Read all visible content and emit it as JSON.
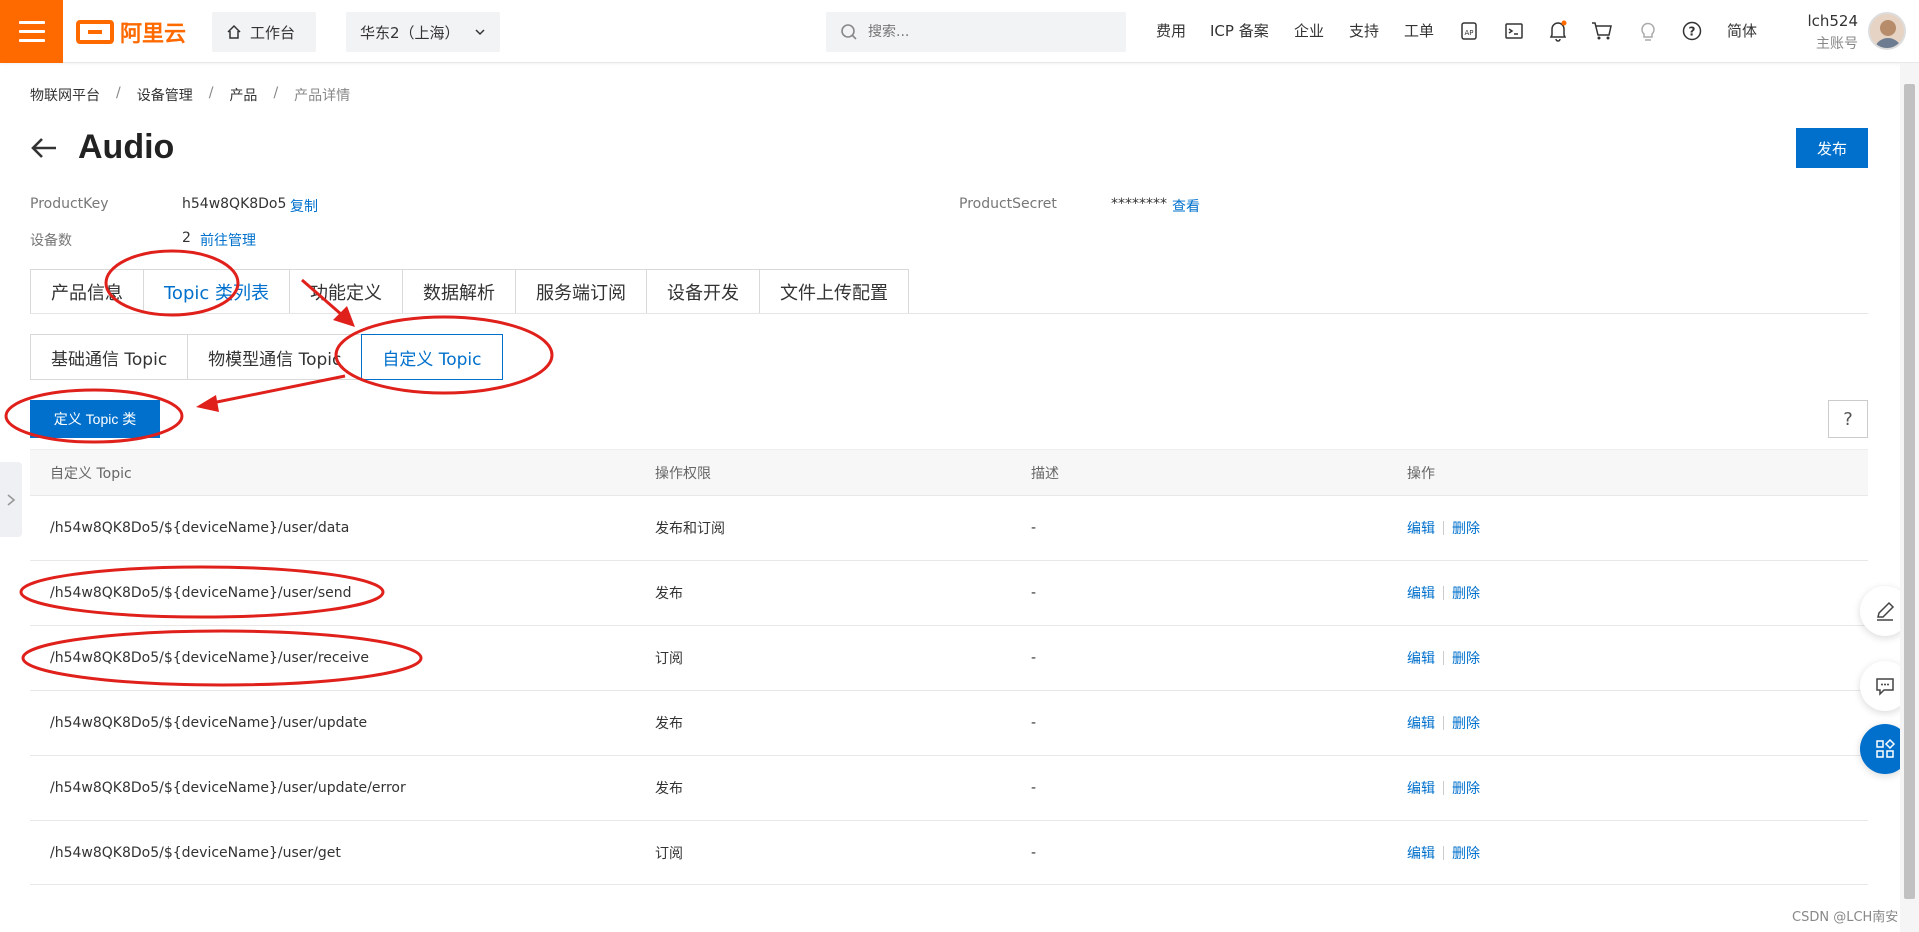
{
  "header": {
    "logo_text": "阿里云",
    "workbench_label": "工作台",
    "region_label": "华东2（上海）",
    "search_placeholder": "搜索...",
    "nav_links": [
      "费用",
      "ICP 备案",
      "企业",
      "支持",
      "工单"
    ],
    "lang_label": "简体",
    "user_name": "lch524",
    "user_role": "主账号"
  },
  "breadcrumb": [
    "物联网平台",
    "设备管理",
    "产品",
    "产品详情"
  ],
  "page": {
    "title": "Audio",
    "publish_label": "发布"
  },
  "meta": {
    "product_key_label": "ProductKey",
    "product_key_value": "h54w8QK8Do5",
    "copy_label": "复制",
    "product_secret_label": "ProductSecret",
    "product_secret_value": "********",
    "view_label": "查看",
    "device_count_label": "设备数",
    "device_count_value": "2",
    "manage_label": "前往管理"
  },
  "tabs": [
    "产品信息",
    "Topic 类列表",
    "功能定义",
    "数据解析",
    "服务端订阅",
    "设备开发",
    "文件上传配置"
  ],
  "subtabs": [
    "基础通信 Topic",
    "物模型通信 Topic",
    "自定义 Topic"
  ],
  "toolbar": {
    "define_label": "定义 Topic 类",
    "help_label": "?"
  },
  "table": {
    "headers": [
      "自定义 Topic",
      "操作权限",
      "描述",
      "操作"
    ],
    "edit_label": "编辑",
    "delete_label": "删除",
    "rows": [
      {
        "topic": "/h54w8QK8Do5/${deviceName}/user/data",
        "permission": "发布和订阅",
        "desc": "-"
      },
      {
        "topic": "/h54w8QK8Do5/${deviceName}/user/send",
        "permission": "发布",
        "desc": "-"
      },
      {
        "topic": "/h54w8QK8Do5/${deviceName}/user/receive",
        "permission": "订阅",
        "desc": "-"
      },
      {
        "topic": "/h54w8QK8Do5/${deviceName}/user/update",
        "permission": "发布",
        "desc": "-"
      },
      {
        "topic": "/h54w8QK8Do5/${deviceName}/user/update/error",
        "permission": "发布",
        "desc": "-"
      },
      {
        "topic": "/h54w8QK8Do5/${deviceName}/user/get",
        "permission": "订阅",
        "desc": "-"
      }
    ]
  },
  "watermark": "CSDN @LCH南安",
  "colors": {
    "brand": "#ff6a00",
    "primary": "#0070cc",
    "annotation": "#e0201b"
  }
}
